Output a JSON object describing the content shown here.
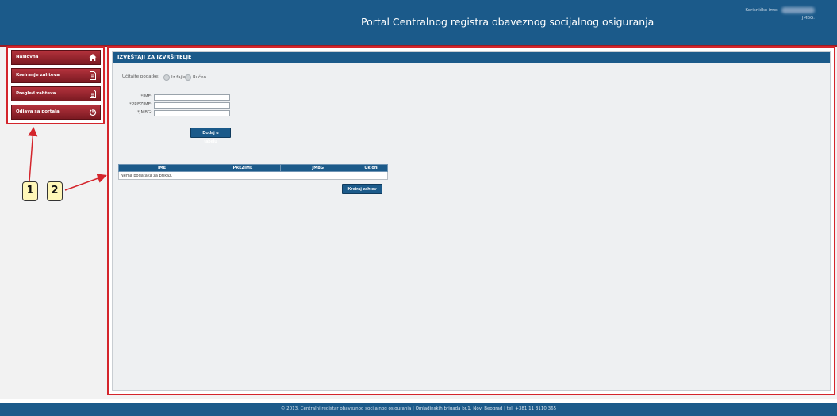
{
  "header": {
    "title": "Portal Centralnog registra obaveznog socijalnog osiguranja",
    "user_label": "Korisničko ime:",
    "jmbg_label": "JMBG:"
  },
  "sidebar": {
    "items": [
      {
        "label": "Naslovna",
        "icon": "home-icon"
      },
      {
        "label": "Kreiranje zahteva",
        "icon": "document-icon"
      },
      {
        "label": "Pregled zahteva",
        "icon": "document-icon"
      },
      {
        "label": "Odjava sa portala",
        "icon": "power-icon"
      }
    ]
  },
  "main": {
    "title": "IZVEŠTAJI ZA IZVRŠITELJE",
    "upload_label": "Učitajte podatke:",
    "radio_file": "Iz fajla",
    "radio_manual": "Ručno",
    "fields": {
      "ime_label": "*IME:",
      "prezime_label": "*PREZIME:",
      "jmbg_label": "*JMBG:"
    },
    "add_button": "Dodaj u tabelu",
    "table": {
      "headers": [
        "IME",
        "PREZIME",
        "JMBG",
        "Ukloni"
      ],
      "empty_text": "Nema podataka za prikaz."
    },
    "create_button": "Kreiraj zahtev"
  },
  "footer": {
    "text": "© 2013. Centralni registar obaveznog socijalnog osiguranja | Omladinskih brigada br.1, Novi Beograd | tel. +381 11 3110 365"
  },
  "callouts": [
    "1",
    "2"
  ],
  "colors": {
    "primary": "#1b5a8a",
    "nav_red": "#9b1c24",
    "callout_red": "#d4252c",
    "callout_bg": "#fff7b8"
  }
}
